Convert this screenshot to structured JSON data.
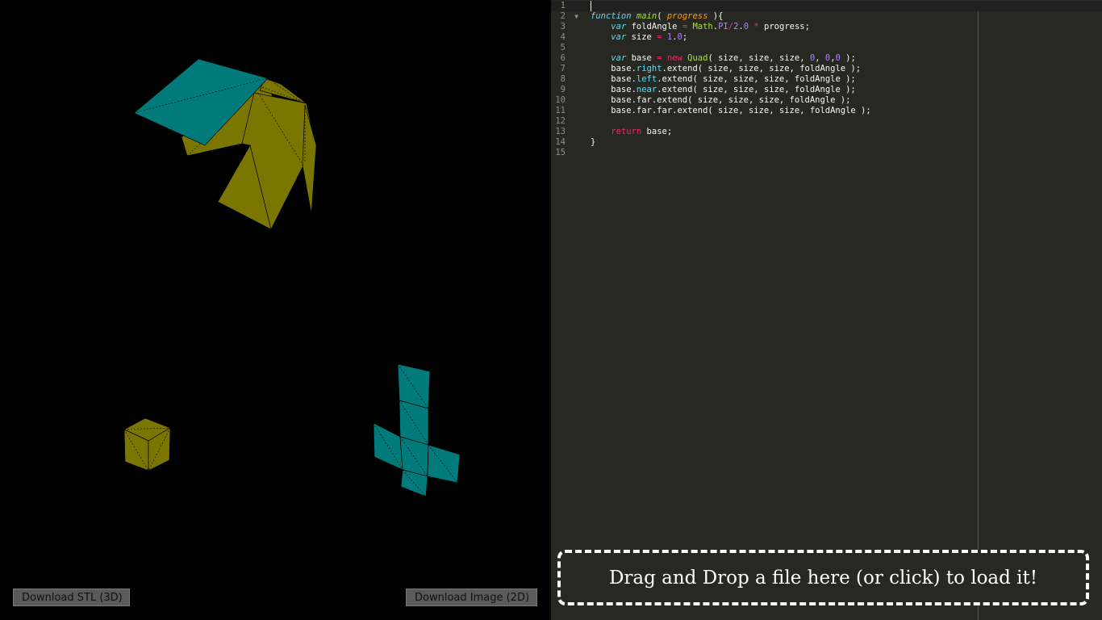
{
  "viewport": {
    "download_stl_label": "Download STL (3D)",
    "download_image_label": "Download Image (2D)",
    "colors": {
      "background": "#000000",
      "olive": "#7b7600",
      "teal": "#007a7a",
      "fold_lines": "#000000"
    }
  },
  "editor": {
    "line_numbers": [
      "1",
      "2",
      "3",
      "4",
      "5",
      "6",
      "7",
      "8",
      "9",
      "10",
      "11",
      "12",
      "13",
      "14",
      "15"
    ],
    "code_lines": [
      "",
      "function main( progress ){",
      "    var foldAngle = Math.PI/2.0 * progress;",
      "    var size = 1.0;",
      "",
      "    var base = new Quad( size, size, size, 0, 0,0 );",
      "    base.right.extend( size, size, size, foldAngle );",
      "    base.left.extend( size, size, size, foldAngle );",
      "    base.near.extend( size, size, size, foldAngle );",
      "    base.far.extend( size, size, size, foldAngle );",
      "    base.far.far.extend( size, size, size, foldAngle );",
      "",
      "    return base;",
      "}",
      ""
    ],
    "colors": {
      "background": "#272822",
      "gutter_text": "#8f908a",
      "text": "#f8f8f2"
    }
  },
  "dropzone": {
    "label": "Drag and Drop a file here (or click) to load it!"
  }
}
